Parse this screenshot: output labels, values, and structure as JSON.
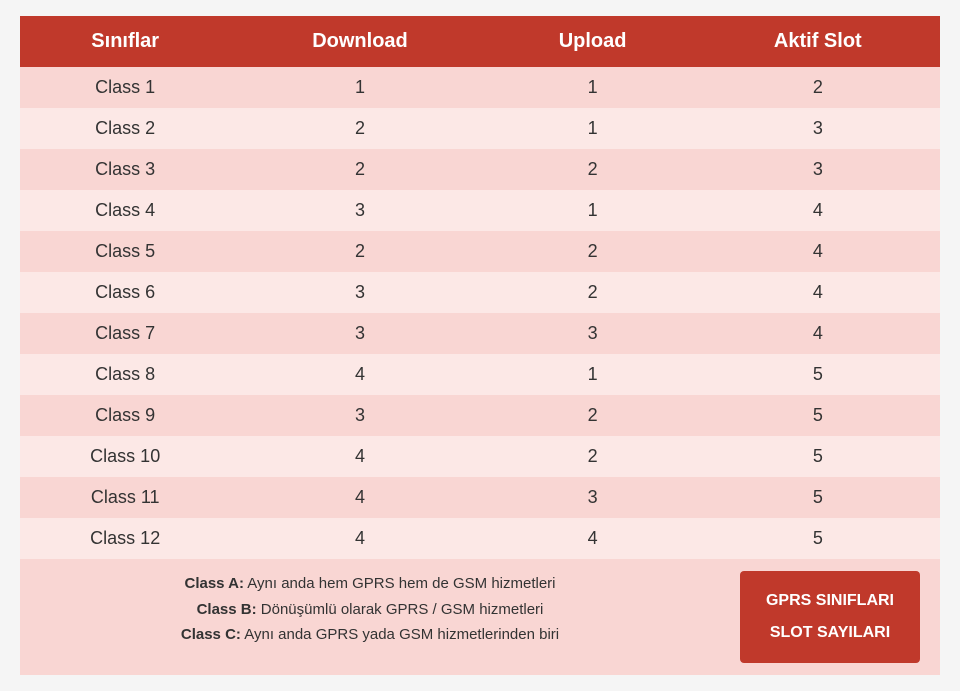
{
  "header": {
    "col1": "Sınıflar",
    "col2": "Download",
    "col3": "Upload",
    "col4": "Aktif Slot"
  },
  "rows": [
    {
      "class": "Class 1",
      "download": "1",
      "upload": "1",
      "aktif": "2"
    },
    {
      "class": "Class 2",
      "download": "2",
      "upload": "1",
      "aktif": "3"
    },
    {
      "class": "Class 3",
      "download": "2",
      "upload": "2",
      "aktif": "3"
    },
    {
      "class": "Class 4",
      "download": "3",
      "upload": "1",
      "aktif": "4"
    },
    {
      "class": "Class 5",
      "download": "2",
      "upload": "2",
      "aktif": "4"
    },
    {
      "class": "Class 6",
      "download": "3",
      "upload": "2",
      "aktif": "4"
    },
    {
      "class": "Class 7",
      "download": "3",
      "upload": "3",
      "aktif": "4"
    },
    {
      "class": "Class 8",
      "download": "4",
      "upload": "1",
      "aktif": "5"
    },
    {
      "class": "Class 9",
      "download": "3",
      "upload": "2",
      "aktif": "5"
    },
    {
      "class": "Class 10",
      "download": "4",
      "upload": "2",
      "aktif": "5"
    },
    {
      "class": "Class 11",
      "download": "4",
      "upload": "3",
      "aktif": "5"
    },
    {
      "class": "Class 12",
      "download": "4",
      "upload": "4",
      "aktif": "5"
    }
  ],
  "footer": {
    "classA_label": "Class A:",
    "classA_text": " Aynı anda hem GPRS hem de GSM hizmetleri",
    "classB_label": "Class B:",
    "classB_text": " Dönüşümlü olarak GPRS / GSM hizmetleri",
    "classC_label": "Class C:",
    "classC_text": " Aynı anda GPRS yada GSM hizmetlerinden biri",
    "gprs_line1": "GPRS SINIFLARI",
    "gprs_line2": "SLOT SAYILARI"
  },
  "colors": {
    "header_bg": "#c0392b",
    "odd_row": "#f9d6d3",
    "even_row": "#fce8e6"
  }
}
